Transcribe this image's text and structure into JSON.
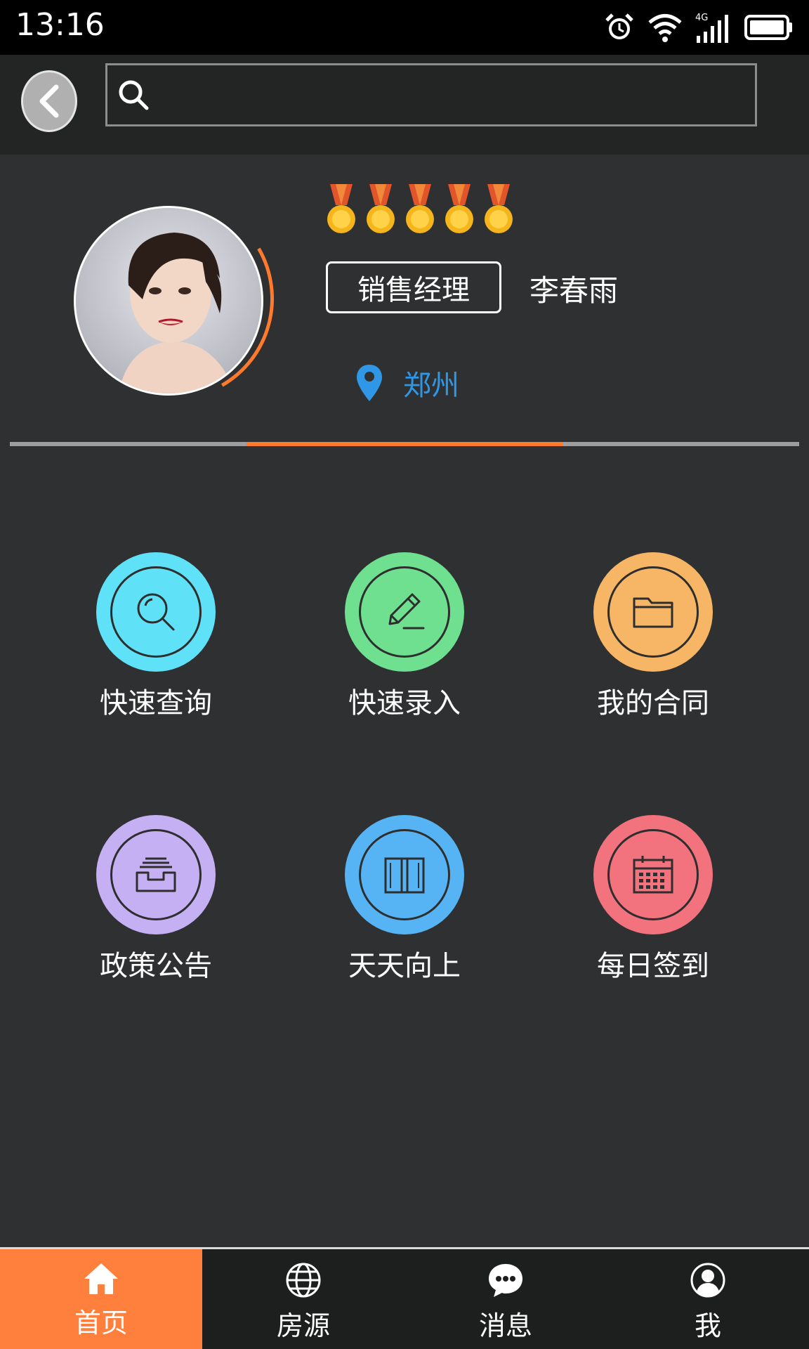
{
  "status_bar": {
    "time": "13:16",
    "network": "4G"
  },
  "search": {
    "placeholder": ""
  },
  "profile": {
    "medal_count": 5,
    "role": "销售经理",
    "name": "李春雨",
    "location": "郑州"
  },
  "grid": [
    {
      "label": "快速查询",
      "color": "#5fe1f8",
      "icon": "search-icon"
    },
    {
      "label": "快速录入",
      "color": "#6fe08f",
      "icon": "pencil-icon"
    },
    {
      "label": "我的合同",
      "color": "#f7b665",
      "icon": "folder-icon"
    },
    {
      "label": "政策公告",
      "color": "#c6b0f4",
      "icon": "inbox-icon"
    },
    {
      "label": "天天向上",
      "color": "#57b4f4",
      "icon": "book-icon"
    },
    {
      "label": "每日签到",
      "color": "#f2727e",
      "icon": "calendar-icon"
    }
  ],
  "nav": [
    {
      "label": "首页",
      "icon": "home-icon",
      "active": true
    },
    {
      "label": "房源",
      "icon": "globe-icon",
      "active": false
    },
    {
      "label": "消息",
      "icon": "chat-icon",
      "active": false
    },
    {
      "label": "我",
      "icon": "user-icon",
      "active": false
    }
  ],
  "colors": {
    "accent": "#ff7a2c",
    "location": "#2f97e6"
  }
}
